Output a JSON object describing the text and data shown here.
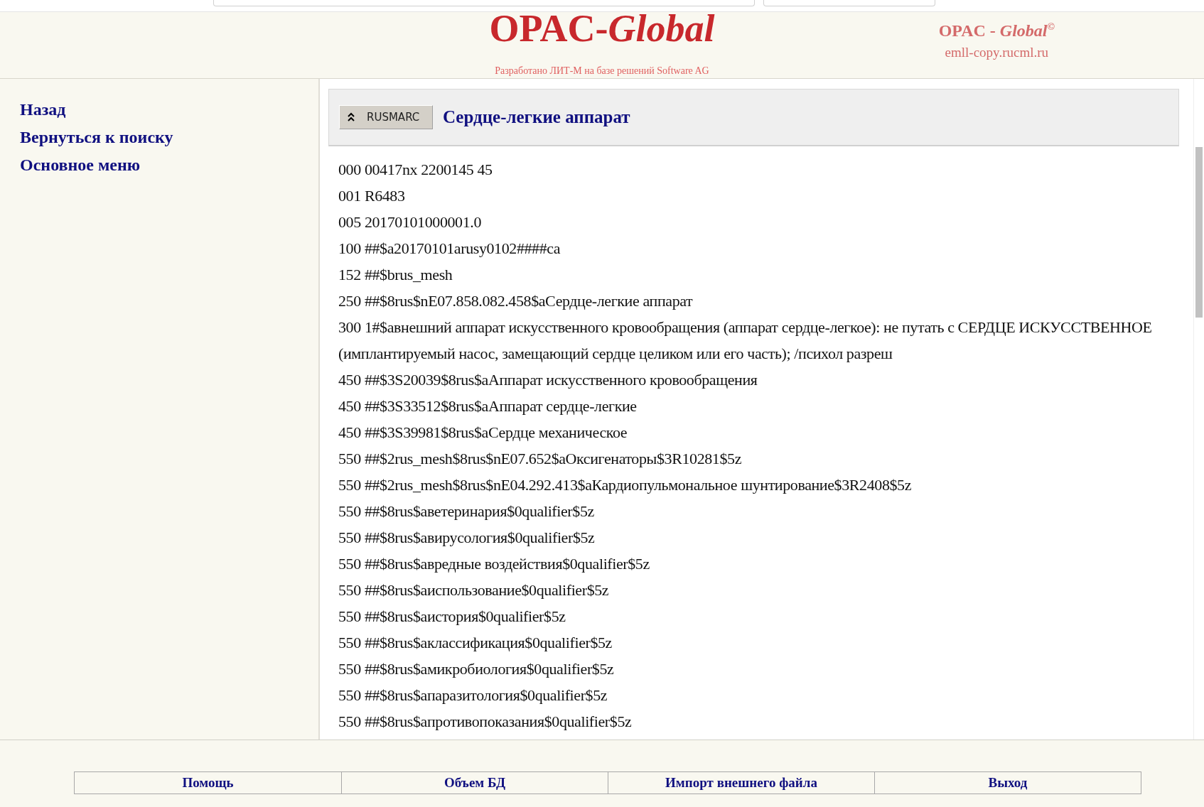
{
  "header": {
    "logo": "OPAC-*Global*",
    "subtitle": "Разработано ЛИТ-М на базе решений Software AG",
    "brand": "OPAC - *Global*$^{©}$",
    "domain": "emll-copy.rucml.ru"
  },
  "sidebar": {
    "links": [
      "Назад",
      "Вернуться к поиску",
      "Основное меню"
    ]
  },
  "record": {
    "format_button": "RUSMARC",
    "title": "Сердце-легкие аппарат",
    "lines": [
      "000 00417nx 2200145 45",
      "001 R6483",
      "005 20170101000001.0",
      "100 ##$a20170101arusy0102####ca",
      "152 ##$brus_mesh",
      "250 ##$8rus$nE07.858.082.458$aСердце-легкие аппарат",
      "300 1#$авнешний аппарат искусственного кровообращения (аппарат сердце-легкое): не путать с СЕРДЦЕ ИСКУССТВЕННОЕ (имплантируемый насос, замещающий сердце целиком или его часть); /психол разреш",
      "450 ##$3S20039$8rus$aАппарат искусственного кровообращения",
      "450 ##$3S33512$8rus$aАппарат сердце-легкие",
      "450 ##$3S39981$8rus$aСердце механическое",
      "550 ##$2rus_mesh$8rus$nE07.652$aОксигенаторы$3R10281$5z",
      "550 ##$2rus_mesh$8rus$nE04.292.413$aКардиопульмональное шунтирование$3R2408$5z",
      "550 ##$8rus$aветеринария$0qualifier$5z",
      "550 ##$8rus$aвирусология$0qualifier$5z",
      "550 ##$8rus$aвредные воздействия$0qualifier$5z",
      "550 ##$8rus$aиспользование$0qualifier$5z",
      "550 ##$8rus$aистория$0qualifier$5z",
      "550 ##$8rus$aклассификация$0qualifier$5z",
      "550 ##$8rus$aмикробиология$0qualifier$5z",
      "550 ##$8rus$aпаразитология$0qualifier$5z",
      "550 ##$8rus$aпротивопоказания$0qualifier$5z"
    ]
  },
  "footer": {
    "buttons": [
      "Помощь",
      "Объем БД",
      "Импорт внешнего файла",
      "Выход"
    ]
  }
}
